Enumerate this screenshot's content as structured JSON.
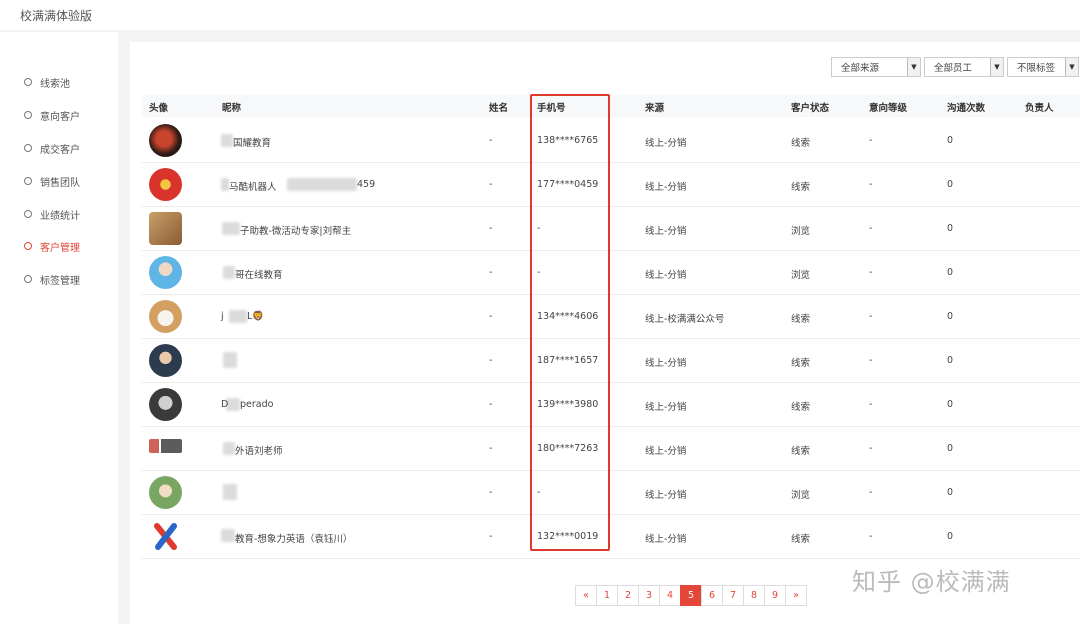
{
  "app_title": "校满满体验版",
  "sidebar": {
    "items": [
      {
        "label": "线索池",
        "active": false
      },
      {
        "label": "意向客户",
        "active": false
      },
      {
        "label": "成交客户",
        "active": false
      },
      {
        "label": "销售团队",
        "active": false
      },
      {
        "label": "业绩统计",
        "active": false
      },
      {
        "label": "客户管理",
        "active": true
      },
      {
        "label": "标签管理",
        "active": false
      }
    ]
  },
  "filters": [
    {
      "label": "全部来源"
    },
    {
      "label": "全部员工"
    },
    {
      "label": "不限标签"
    }
  ],
  "table": {
    "headers": [
      "头像",
      "昵称",
      "姓名",
      "手机号",
      "来源",
      "客户状态",
      "意向等级",
      "沟通次数",
      "负责人"
    ],
    "rows": [
      {
        "nickname": "国耀教育",
        "name": "-",
        "phone": "138****6765",
        "source": "线上-分销",
        "status": "线索",
        "level": "-",
        "count": "0"
      },
      {
        "nickname": "马酷机器人",
        "nickname_tail": "459",
        "name": "-",
        "phone": "177****0459",
        "source": "线上-分销",
        "status": "线索",
        "level": "-",
        "count": "0"
      },
      {
        "nickname": "子助教-微活动专家|刘帮主",
        "name": "-",
        "phone": "-",
        "source": "线上-分销",
        "status": "浏览",
        "level": "-",
        "count": "0"
      },
      {
        "nickname": "哥在线教育",
        "name": "-",
        "phone": "-",
        "source": "线上-分销",
        "status": "浏览",
        "level": "-",
        "count": "0"
      },
      {
        "nickname": "j",
        "nickname_tail": "L🦁",
        "name": "-",
        "phone": "134****4606",
        "source": "线上-校满满公众号",
        "status": "线索",
        "level": "-",
        "count": "0"
      },
      {
        "nickname": "",
        "name": "-",
        "phone": "187****1657",
        "source": "线上-分销",
        "status": "线索",
        "level": "-",
        "count": "0"
      },
      {
        "nickname": "D",
        "nickname_tail": "perado",
        "name": "-",
        "phone": "139****3980",
        "source": "线上-分销",
        "status": "线索",
        "level": "-",
        "count": "0"
      },
      {
        "nickname": "外语刘老师",
        "name": "-",
        "phone": "180****7263",
        "source": "线上-分销",
        "status": "线索",
        "level": "-",
        "count": "0"
      },
      {
        "nickname": "",
        "name": "-",
        "phone": "-",
        "source": "线上-分销",
        "status": "浏览",
        "level": "-",
        "count": "0"
      },
      {
        "nickname": "教育-想象力英语（袁钰川）",
        "name": "-",
        "phone": "132****0019",
        "source": "线上-分销",
        "status": "线索",
        "level": "-",
        "count": "0"
      }
    ]
  },
  "pagination": {
    "prev": "«",
    "pages": [
      "1",
      "2",
      "3",
      "4",
      "5",
      "6",
      "7",
      "8",
      "9"
    ],
    "current": "5",
    "next": "»"
  },
  "watermark": "知乎 @校满满",
  "colors": {
    "accent": "#e4463a",
    "highlight_box": "#e0392d"
  }
}
